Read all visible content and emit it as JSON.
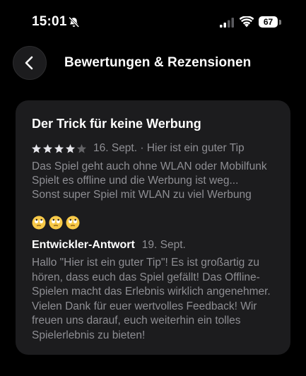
{
  "status_bar": {
    "time": "15:01",
    "battery_level": "67",
    "icons": [
      "bell-slash-icon",
      "signal-icon",
      "wifi-icon",
      "battery-icon"
    ]
  },
  "header": {
    "back_icon": "chevron-left-icon",
    "title": "Bewertungen & Rezensionen"
  },
  "review": {
    "title": "Der Trick für keine Werbung",
    "rating": 4,
    "rating_max": 5,
    "meta": "16. Sept. · Hier ist ein guter Tip",
    "body_lines": [
      "Das Spiel geht auch ohne WLAN oder Mobilfunk Spielt es offline und die Werbung ist weg...",
      "Sonst super Spiel mit WLAN zu viel Werbung"
    ],
    "emojis": [
      "rolling-eyes-emoji",
      "rolling-eyes-emoji",
      "rolling-eyes-emoji"
    ],
    "developer_reply": {
      "label": "Entwickler-Antwort",
      "date": "19. Sept.",
      "text": "Hallo \"Hier ist ein guter Tip\"! Es ist großartig zu hören, dass euch das Spiel gefällt! Das Offline-Spielen macht das Erlebnis wirklich angenehmer. Vielen Dank für euer wertvolles Feedback! Wir freuen uns darauf, euch weiterhin ein tolles Spielerlebnis zu bieten!"
    }
  },
  "colors": {
    "background": "#000000",
    "card": "#1c1c1e",
    "secondary_text": "#8e8e93",
    "star_filled": "#e5e5ea",
    "star_empty": "#636366"
  }
}
